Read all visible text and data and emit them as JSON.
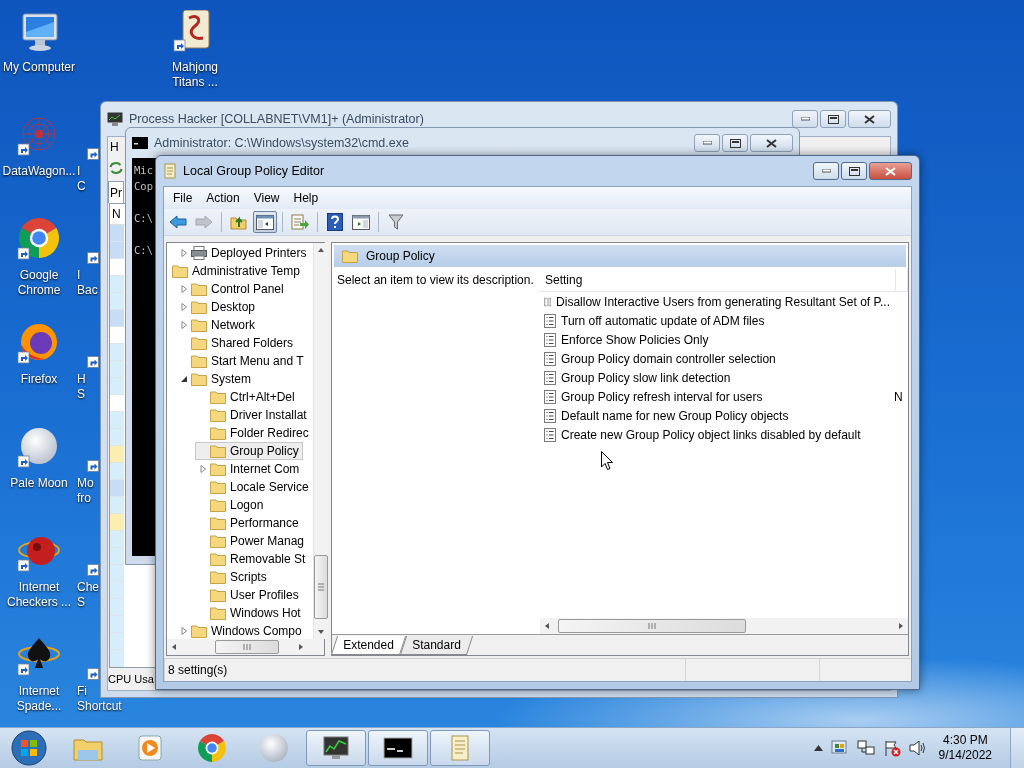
{
  "desktop": {
    "columns": [
      [
        {
          "lines": [
            "My Computer"
          ],
          "kind": "computer"
        },
        {
          "lines": [
            "DataWagon..."
          ],
          "kind": "network"
        },
        {
          "lines": [
            "Google",
            "Chrome"
          ],
          "kind": "chrome"
        },
        {
          "lines": [
            "Firefox"
          ],
          "kind": "firefox"
        },
        {
          "lines": [
            "Pale Moon"
          ],
          "kind": "moon"
        },
        {
          "lines": [
            "Internet",
            "Checkers ..."
          ],
          "kind": "checkers"
        },
        {
          "lines": [
            "Internet",
            "Spade..."
          ],
          "kind": "spades"
        }
      ],
      [
        {
          "lines": [
            "I",
            "C"
          ],
          "kind": "covered"
        },
        {
          "lines": [
            "I",
            "Bac"
          ],
          "kind": "covered"
        },
        {
          "lines": [
            "H",
            "S"
          ],
          "kind": "covered"
        },
        {
          "lines": [
            "Mo",
            "fro"
          ],
          "kind": "covered"
        },
        {
          "lines": [
            "Che",
            "S"
          ],
          "kind": "covered"
        },
        {
          "lines": [
            "Fi",
            "Shortcut"
          ],
          "kind": "covered"
        }
      ],
      [
        {
          "lines": [
            "Mahjong",
            "Titans ..."
          ],
          "kind": "mahjong"
        }
      ]
    ]
  },
  "process_hacker": {
    "title": "Process Hacker [COLLABNET\\VM1]+ (Administrator)",
    "menu": [
      "H"
    ],
    "tab": "Pr",
    "column": "N",
    "status": "CPU Usa",
    "rows": [
      {
        "color": "#c7dcf5"
      },
      {
        "color": "#c7dcf5"
      },
      {
        "color": "#ffffff"
      },
      {
        "color": "#d5eefa"
      },
      {
        "color": "#d5eefa"
      },
      {
        "color": "#c7dcf5"
      },
      {
        "color": "#ffffff"
      },
      {
        "color": "#d5eefa"
      },
      {
        "color": "#d5eefa"
      },
      {
        "color": "#d5eefa"
      },
      {
        "color": "#ffffff"
      },
      {
        "color": "#d5eefa"
      },
      {
        "color": "#d5eefa"
      },
      {
        "color": "#fbeeb0"
      },
      {
        "color": "#d5eefa"
      },
      {
        "color": "#c7dcf5"
      },
      {
        "color": "#d5eefa"
      },
      {
        "color": "#fbeeb0"
      },
      {
        "color": "#d5eefa"
      },
      {
        "color": "#d5eefa"
      },
      {
        "color": "#d5eefa"
      },
      {
        "color": "#d5eefa"
      },
      {
        "color": "#d5eefa"
      },
      {
        "color": "#d5eefa"
      },
      {
        "color": "#d5eefa"
      },
      {
        "color": "#d5eefa"
      }
    ]
  },
  "console": {
    "title": "Administrator: C:\\Windows\\system32\\cmd.exe",
    "lines": [
      "Mic",
      "Cop",
      "C:\\",
      "C:\\"
    ]
  },
  "editor": {
    "title": "Local Group Policy Editor",
    "menu": [
      "File",
      "Action",
      "View",
      "Help"
    ],
    "toolbar_groups": [
      [
        {
          "kind": "back",
          "pressed": false,
          "disabled": false
        },
        {
          "kind": "forward",
          "pressed": false,
          "disabled": true
        }
      ],
      [
        {
          "kind": "up",
          "pressed": false,
          "disabled": false
        },
        {
          "kind": "tree-toggle",
          "pressed": true,
          "disabled": false
        }
      ],
      [
        {
          "kind": "export",
          "pressed": false,
          "disabled": false
        }
      ],
      [
        {
          "kind": "help",
          "pressed": false,
          "disabled": false
        },
        {
          "kind": "panel-toggle",
          "pressed": false,
          "disabled": false
        }
      ],
      [
        {
          "kind": "filter",
          "pressed": false,
          "disabled": false
        }
      ]
    ],
    "tree": [
      {
        "label": "Deployed Printers",
        "kind": "printer",
        "expanded": false,
        "selected": false
      },
      {
        "label": "Administrative Temp",
        "kind": "folder",
        "selected": false,
        "children": [
          {
            "label": "Control Panel",
            "kind": "folder",
            "expanded": false,
            "selected": false
          },
          {
            "label": "Desktop",
            "kind": "folder",
            "expanded": false,
            "selected": false
          },
          {
            "label": "Network",
            "kind": "folder",
            "expanded": false,
            "selected": false
          },
          {
            "label": "Shared Folders",
            "kind": "folder",
            "selected": false
          },
          {
            "label": "Start Menu and T",
            "kind": "folder",
            "selected": false
          },
          {
            "label": "System",
            "kind": "folder",
            "expanded": true,
            "selected": false,
            "children": [
              {
                "label": "Ctrl+Alt+Del",
                "kind": "folder",
                "selected": false
              },
              {
                "label": "Driver Installat",
                "kind": "folder",
                "selected": false
              },
              {
                "label": "Folder Redirec",
                "kind": "folder",
                "selected": false
              },
              {
                "label": "Group Policy",
                "kind": "folder",
                "selected": true
              },
              {
                "label": "Internet Com",
                "kind": "folder",
                "expanded": false,
                "selected": false
              },
              {
                "label": "Locale Service",
                "kind": "folder",
                "selected": false
              },
              {
                "label": "Logon",
                "kind": "folder",
                "selected": false
              },
              {
                "label": "Performance",
                "kind": "folder",
                "selected": false
              },
              {
                "label": "Power Manag",
                "kind": "folder",
                "selected": false
              },
              {
                "label": "Removable St",
                "kind": "folder",
                "selected": false
              },
              {
                "label": "Scripts",
                "kind": "folder",
                "selected": false
              },
              {
                "label": "User Profiles",
                "kind": "folder",
                "selected": false
              },
              {
                "label": "Windows Hot",
                "kind": "folder",
                "selected": false
              }
            ]
          },
          {
            "label": "Windows Compo",
            "kind": "folder",
            "expanded": false,
            "selected": false
          }
        ]
      }
    ],
    "heading": "Group Policy",
    "description": "Select an item to view its description.",
    "columns": [
      "Setting"
    ],
    "rows": [
      {
        "setting": "Disallow Interactive Users from generating Resultant Set of P..."
      },
      {
        "setting": "Turn off automatic update of ADM files"
      },
      {
        "setting": "Enforce Show Policies Only"
      },
      {
        "setting": "Group Policy domain controller selection"
      },
      {
        "setting": "Group Policy slow link detection"
      },
      {
        "setting": "Group Policy refresh interval for users",
        "column_2": "N"
      },
      {
        "setting": "Default name for new Group Policy objects"
      },
      {
        "setting": "Create new Group Policy object links disabled by default"
      }
    ],
    "tabs": [
      {
        "label": "Extended",
        "selected": true
      },
      {
        "label": "Standard",
        "selected": false
      }
    ],
    "status_bar": "8 setting(s)"
  },
  "taskbar": {
    "items": [
      {
        "kind": "explorer",
        "running": false
      },
      {
        "kind": "media",
        "running": false
      },
      {
        "kind": "chrome",
        "running": false
      },
      {
        "kind": "moon",
        "running": false
      },
      {
        "kind": "process-hacker",
        "running": true
      },
      {
        "kind": "console",
        "running": true
      },
      {
        "kind": "policy-editor",
        "running": true
      }
    ],
    "clock": {
      "time": "4:30 PM",
      "date": "9/14/2022"
    }
  }
}
